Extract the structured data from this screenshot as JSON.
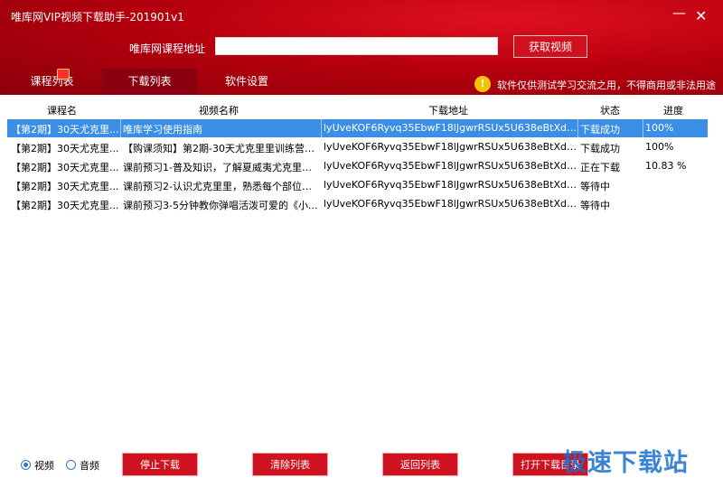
{
  "window": {
    "title": "唯库网VIP视频下载助手-201901v1",
    "minimize": "—",
    "close": "✕"
  },
  "url_bar": {
    "label": "唯库网课程地址",
    "value": "",
    "placeholder": ""
  },
  "fetch_button": "获取视频",
  "tabs": [
    "课程列表",
    "下载列表",
    "软件设置"
  ],
  "notice": {
    "icon": "!",
    "text": "软件仅供测试学习交流之用，不得商用或非法用途"
  },
  "table": {
    "columns": [
      "课程名",
      "视频名称",
      "下载地址",
      "状态",
      "进度"
    ],
    "rows": [
      {
        "course": "【第2期】30天尤克里...",
        "video": "唯库学习使用指南",
        "url": "lyUveKOF6Ryvq35EbwF18lJgwrRSUx5U638eBtXdvu3...",
        "status": "下载成功",
        "progress": "100%"
      },
      {
        "course": "【第2期】30天尤克里...",
        "video": "【购课须知】第2期-30天尤克里里训练营，...",
        "url": "lyUveKOF6Ryvq35EbwF18lJgwrRSUx5U638eBtXdvu3...",
        "status": "下载成功",
        "progress": "100%"
      },
      {
        "course": "【第2期】30天尤克里...",
        "video": "课前预习1-普及知识，了解夏威夷尤克里里...",
        "url": "lyUveKOF6Ryvq35EbwF18lJgwrRSUx5U638eBtXdvu3...",
        "status": "正在下载",
        "progress": "10.83 %"
      },
      {
        "course": "【第2期】30天尤克里...",
        "video": "课前预习2-认识尤克里里，熟悉每个部位的...",
        "url": "lyUveKOF6Ryvq35EbwF18lJgwrRSUx5U638eBtXdvu3...",
        "status": "等待中",
        "progress": ""
      },
      {
        "course": "【第2期】30天尤克里...",
        "video": "课前预习3-5分钟教你弹唱活泼可爱的《小...",
        "url": "lyUveKOF6Ryvq35EbwF18lJgwrRSUx5U638eBtXdvu3...",
        "status": "等待中",
        "progress": ""
      }
    ]
  },
  "bottom": {
    "radio_video": "视频",
    "radio_audio": "音频",
    "buttons": [
      "停止下载",
      "清除列表",
      "返回列表",
      "打开下载目录"
    ]
  },
  "watermark": "极速下载站",
  "colors": {
    "header_red": "#c00010",
    "selected_row": "#3a8ee6",
    "watermark": "#1a6fd0"
  }
}
